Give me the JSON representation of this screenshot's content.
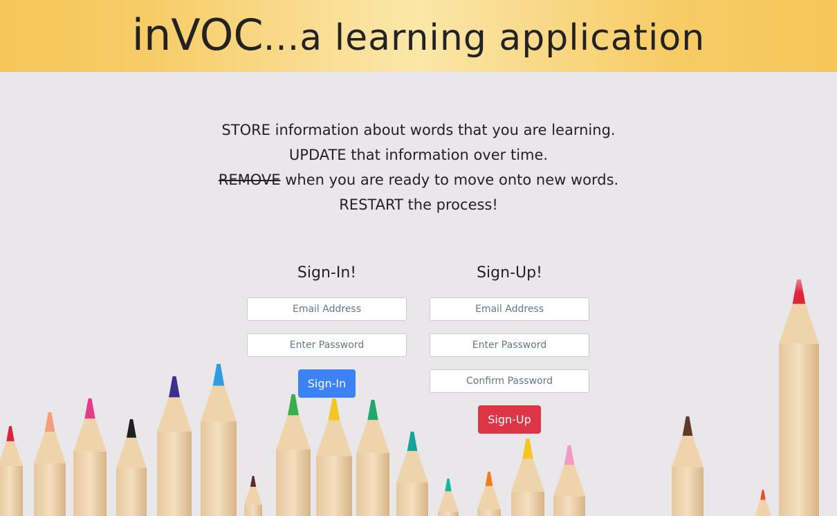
{
  "header": {
    "brand": "inVOC",
    "tagline": "...a learning application"
  },
  "intro": {
    "line1_keyword": "STORE",
    "line1_rest": " information about words that you are learning.",
    "line2_keyword": "UPDATE",
    "line2_rest": " that information over time.",
    "line3_keyword": "REMOVE",
    "line3_rest": " when you are ready to move onto new words.",
    "line4_keyword": "RESTART",
    "line4_rest": " the process!"
  },
  "signin": {
    "heading": "Sign-In!",
    "email_placeholder": "Email Address",
    "password_placeholder": "Enter Password",
    "button_label": "Sign-In"
  },
  "signup": {
    "heading": "Sign-Up!",
    "email_placeholder": "Email Address",
    "password_placeholder": "Enter Password",
    "confirm_placeholder": "Confirm Password",
    "button_label": "Sign-Up"
  },
  "colors": {
    "header_bg": "#f6c659",
    "signin_button": "#3b82f6",
    "signup_button": "#dc3545"
  },
  "background_image": "colored-pencils"
}
